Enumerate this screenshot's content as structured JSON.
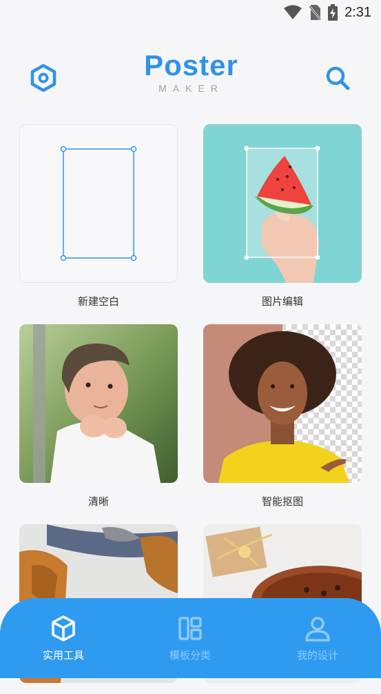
{
  "status_bar": {
    "time": "2:31",
    "icons": [
      "wifi-icon",
      "no-sim-icon",
      "battery-charging-icon"
    ]
  },
  "header": {
    "logo_title": "Poster",
    "logo_subtitle": "MAKER",
    "left_icon": "settings-hexagon-icon",
    "right_icon": "search-icon",
    "accent_color": "#2f93ea"
  },
  "tools": [
    {
      "label": "新建空白",
      "image": "blank-canvas"
    },
    {
      "label": "图片编辑",
      "image": "watermelon-photo"
    },
    {
      "label": "清晰",
      "image": "child-portrait-photo"
    },
    {
      "label": "智能抠图",
      "image": "woman-cutout-photo"
    },
    {
      "label": "",
      "image": "leather-bag-photo"
    },
    {
      "label": "",
      "image": "gift-box-cake-photo"
    }
  ],
  "bottom_nav": {
    "background": "#2f9bf0",
    "items": [
      {
        "label": "实用工具",
        "icon": "cube-icon",
        "active": true
      },
      {
        "label": "模板分类",
        "icon": "template-layout-icon",
        "active": false
      },
      {
        "label": "我的设计",
        "icon": "user-icon",
        "active": false
      }
    ]
  }
}
